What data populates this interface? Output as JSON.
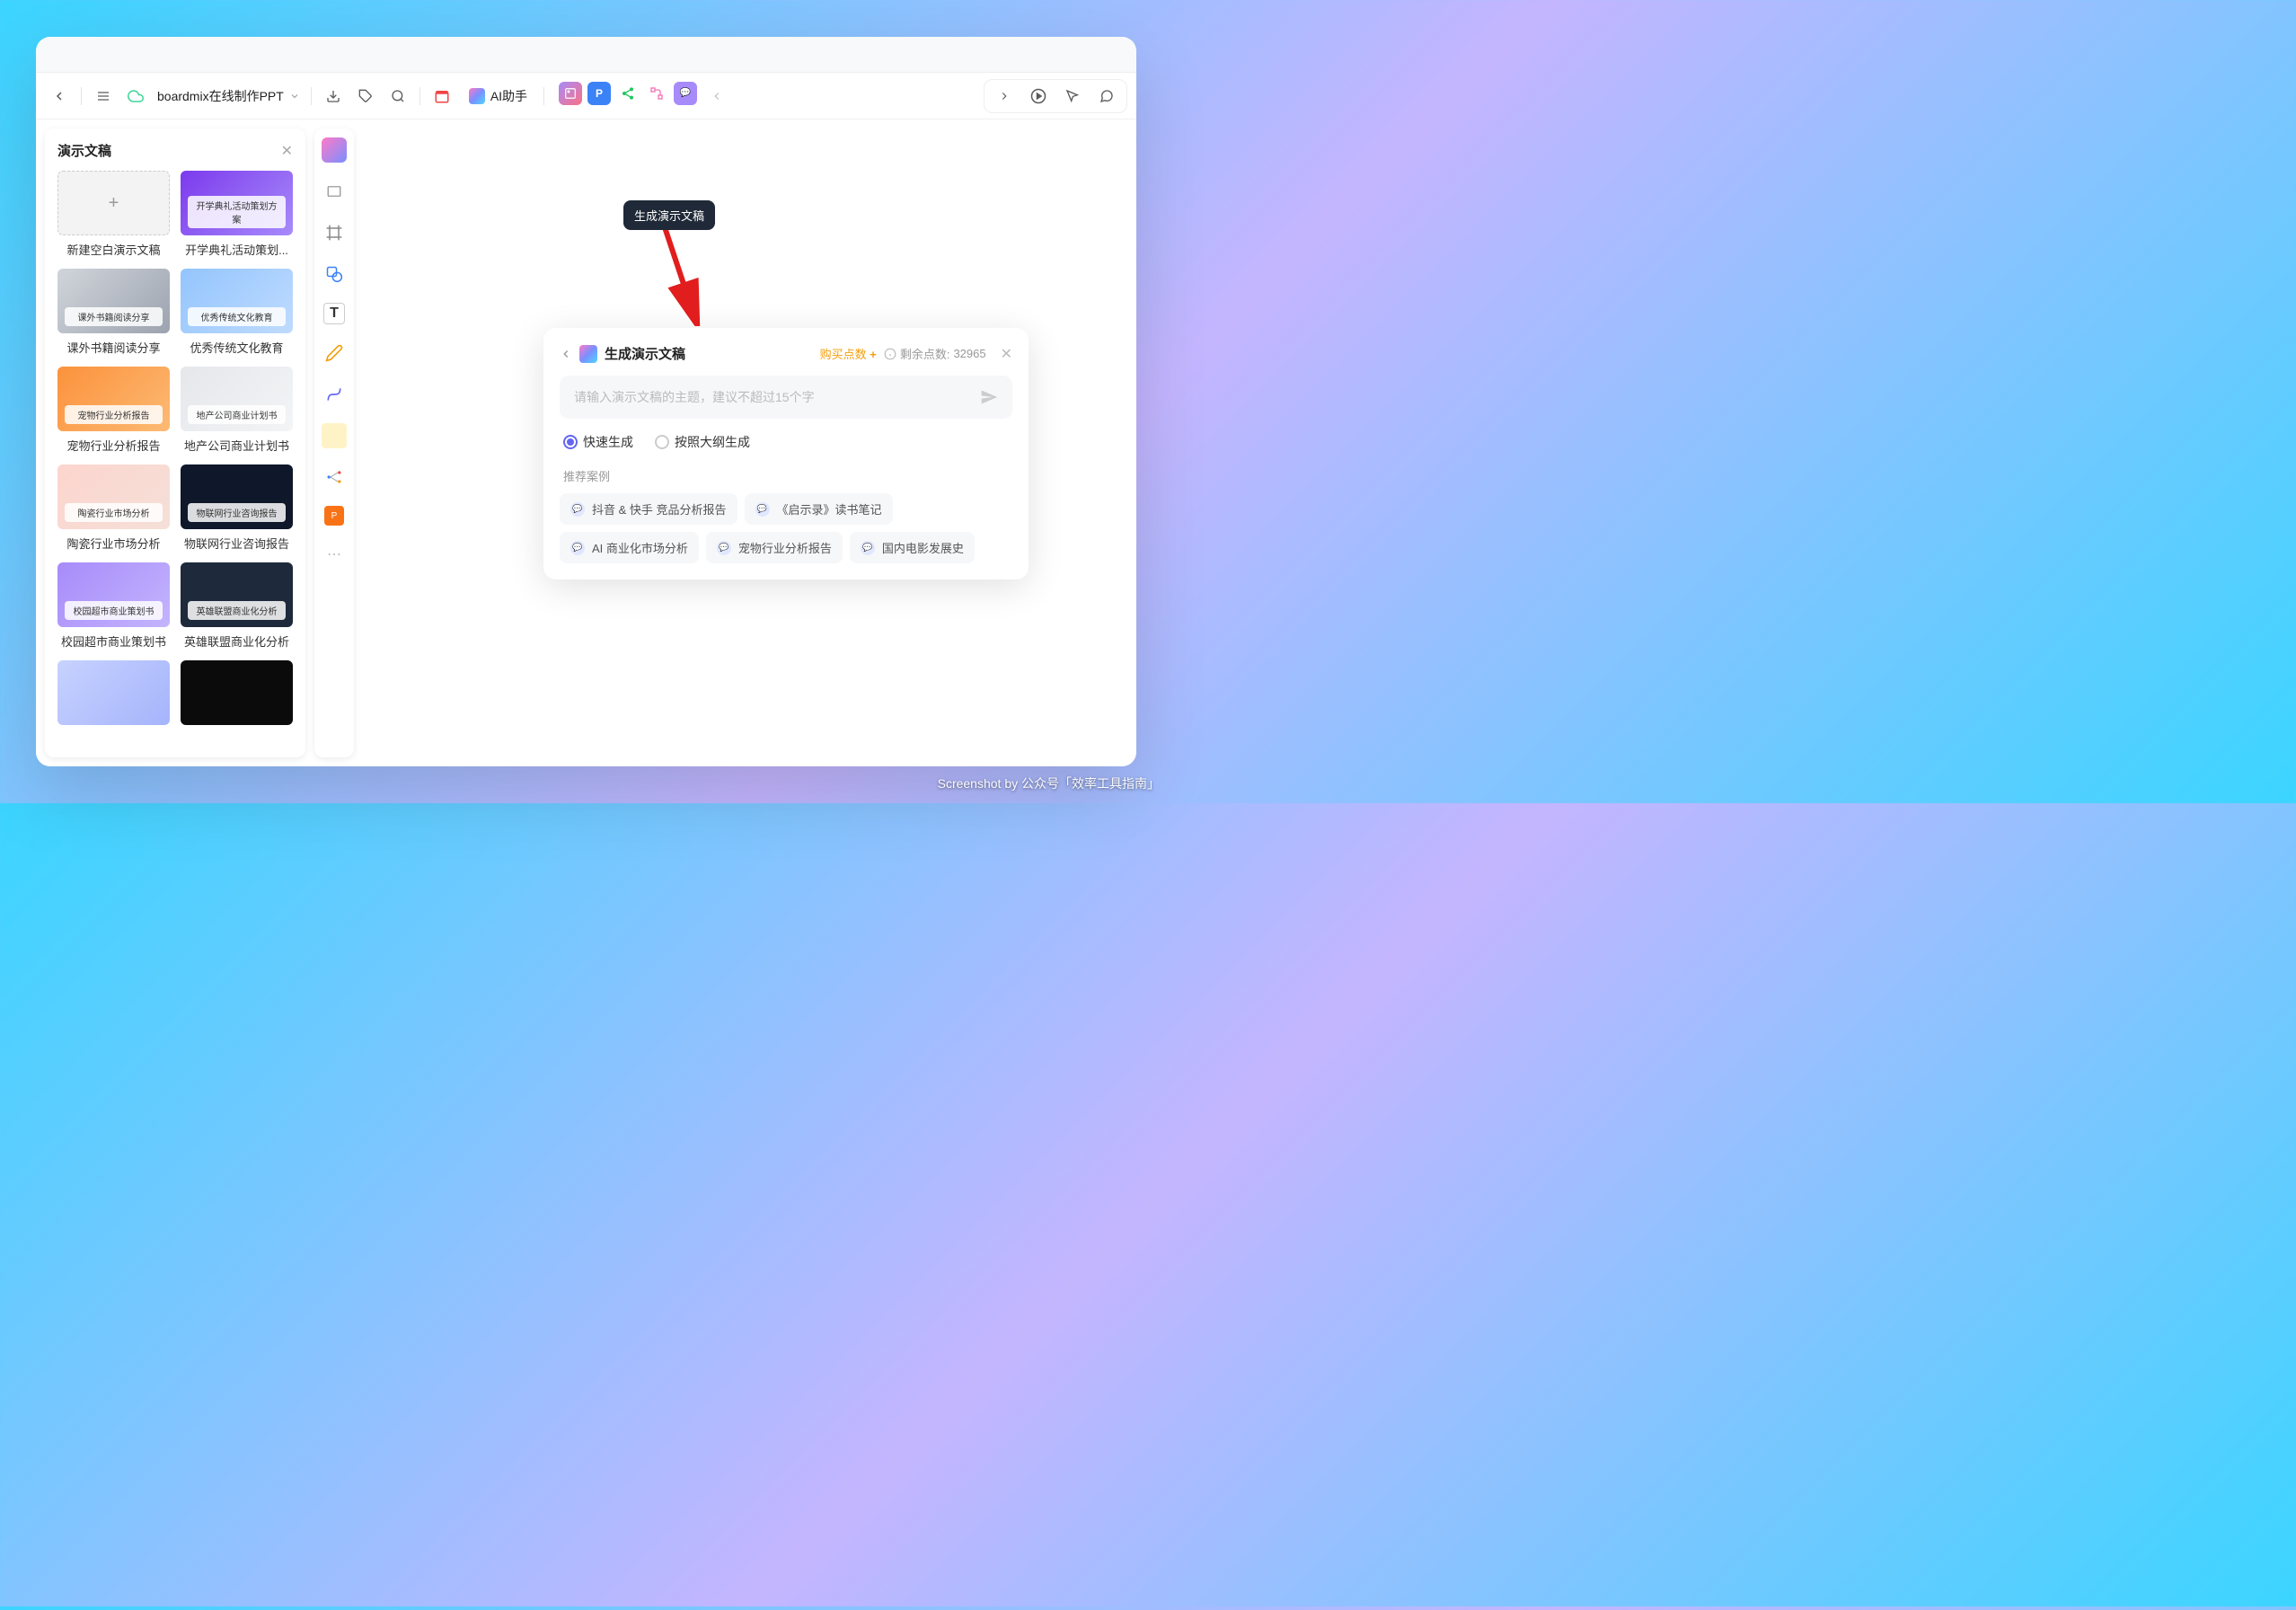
{
  "toolbar": {
    "doc_title": "boardmix在线制作PPT",
    "ai_label": "AI助手"
  },
  "tooltip": "生成演示文稿",
  "sidebar": {
    "title": "演示文稿",
    "templates": [
      {
        "label": "新建空白演示文稿",
        "overlay": "",
        "cls": "thumb-new",
        "plus": true
      },
      {
        "label": "开学典礼活动策划...",
        "overlay": "开学典礼活动策划方案",
        "cls": "thumb-1"
      },
      {
        "label": "课外书籍阅读分享",
        "overlay": "课外书籍阅读分享",
        "cls": "thumb-2"
      },
      {
        "label": "优秀传统文化教育",
        "overlay": "优秀传统文化教育",
        "cls": "thumb-3"
      },
      {
        "label": "宠物行业分析报告",
        "overlay": "宠物行业分析报告",
        "cls": "thumb-4"
      },
      {
        "label": "地产公司商业计划书",
        "overlay": "地产公司商业计划书",
        "cls": "thumb-5"
      },
      {
        "label": "陶瓷行业市场分析",
        "overlay": "陶瓷行业市场分析",
        "cls": "thumb-6"
      },
      {
        "label": "物联网行业咨询报告",
        "overlay": "物联网行业咨询报告",
        "cls": "thumb-7"
      },
      {
        "label": "校园超市商业策划书",
        "overlay": "校园超市商业策划书",
        "cls": "thumb-8"
      },
      {
        "label": "英雄联盟商业化分析",
        "overlay": "英雄联盟商业化分析",
        "cls": "thumb-9"
      },
      {
        "label": "",
        "overlay": "",
        "cls": "thumb-10"
      },
      {
        "label": "",
        "overlay": "",
        "cls": "thumb-11"
      }
    ]
  },
  "ai_panel": {
    "title": "生成演示文稿",
    "buy_points": "购买点数",
    "points_remain_label": "剩余点数:",
    "points_remain_value": "32965",
    "placeholder": "请输入演示文稿的主题，建议不超过15个字",
    "radio1": "快速生成",
    "radio2": "按照大纲生成",
    "examples_label": "推荐案例",
    "examples": [
      "抖音 & 快手 竞品分析报告",
      "《启示录》读书笔记",
      "AI 商业化市场分析",
      "宠物行业分析报告",
      "国内电影发展史"
    ]
  },
  "watermark": "Screenshot by 公众号「效率工具指南」"
}
